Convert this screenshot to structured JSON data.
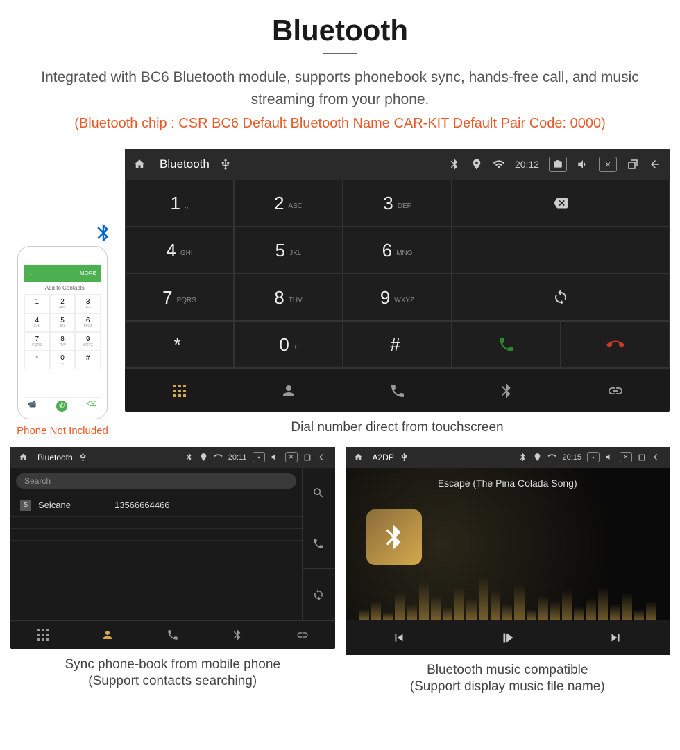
{
  "header": {
    "title": "Bluetooth",
    "subtitle": "Integrated with BC6 Bluetooth module, supports phonebook sync, hands-free call, and music streaming from your phone.",
    "specs": "(Bluetooth chip : CSR BC6    Default Bluetooth Name CAR-KIT    Default Pair Code: 0000)"
  },
  "phone": {
    "add_contacts": "+  Add to Contacts",
    "more": "MORE",
    "caption": "Phone Not Included",
    "keys": [
      {
        "n": "1",
        "l": ""
      },
      {
        "n": "2",
        "l": "ABC"
      },
      {
        "n": "3",
        "l": "DEF"
      },
      {
        "n": "4",
        "l": "GHI"
      },
      {
        "n": "5",
        "l": "JKL"
      },
      {
        "n": "6",
        "l": "MNO"
      },
      {
        "n": "7",
        "l": "PQRS"
      },
      {
        "n": "8",
        "l": "TUV"
      },
      {
        "n": "9",
        "l": "WXYZ"
      },
      {
        "n": "*",
        "l": ""
      },
      {
        "n": "0",
        "l": "+"
      },
      {
        "n": "#",
        "l": ""
      }
    ]
  },
  "dialer": {
    "statusbar_title": "Bluetooth",
    "time": "20:12",
    "keys": [
      {
        "n": "1",
        "l": ".,"
      },
      {
        "n": "2",
        "l": "ABC"
      },
      {
        "n": "3",
        "l": "DEF"
      },
      {
        "n": "4",
        "l": "GHI"
      },
      {
        "n": "5",
        "l": "JKL"
      },
      {
        "n": "6",
        "l": "MNO"
      },
      {
        "n": "7",
        "l": "PQRS"
      },
      {
        "n": "8",
        "l": "TUV"
      },
      {
        "n": "9",
        "l": "WXYZ"
      },
      {
        "n": "*",
        "l": ""
      },
      {
        "n": "0",
        "l": "+"
      },
      {
        "n": "#",
        "l": ""
      }
    ],
    "caption": "Dial number direct from touchscreen"
  },
  "contacts": {
    "statusbar_title": "Bluetooth",
    "time": "20:11",
    "search_placeholder": "Search",
    "items": [
      {
        "badge": "S",
        "name": "Seicane",
        "number": "13566664466"
      }
    ],
    "caption1": "Sync phone-book from mobile phone",
    "caption2": "(Support contacts searching)"
  },
  "music": {
    "statusbar_title": "A2DP",
    "time": "20:15",
    "song": "Escape (The Pina Colada Song)",
    "caption1": "Bluetooth music compatible",
    "caption2": "(Support display music file name)"
  }
}
